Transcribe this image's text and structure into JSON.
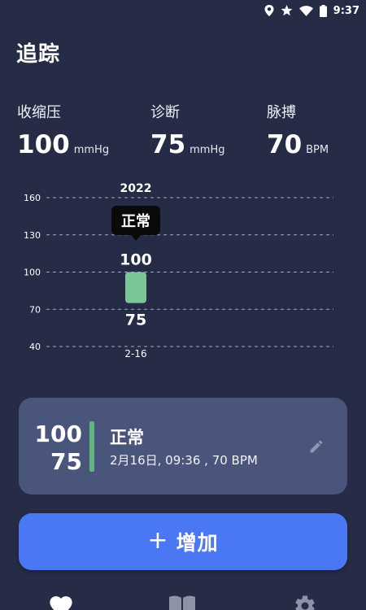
{
  "status_bar": {
    "time": "9:37",
    "icons": [
      "location-icon",
      "star-icon",
      "wifi-icon",
      "battery-icon"
    ]
  },
  "header": {
    "title": "追踪"
  },
  "metrics": [
    {
      "label": "收缩压",
      "value": "100",
      "unit": "mmHg"
    },
    {
      "label": "诊断",
      "value": "75",
      "unit": "mmHg"
    },
    {
      "label": "脉搏",
      "value": "70",
      "unit": "BPM"
    }
  ],
  "chart_data": {
    "type": "bar",
    "title": "",
    "year_label": "2022",
    "y_ticks": [
      160,
      130,
      100,
      70,
      40
    ],
    "ylim": [
      40,
      160
    ],
    "grid": true,
    "categories": [
      "2-16"
    ],
    "bars": [
      {
        "x": "2-16",
        "low": 75,
        "high": 100,
        "status": "正常"
      }
    ],
    "colors": {
      "bar": "#7cc596",
      "grid": "#a5aac0",
      "tooltip_bg": "#0a0a0a"
    }
  },
  "record": {
    "systolic": "100",
    "diastolic": "75",
    "status": "正常",
    "detail": "2月16日, 09:36 , 70 BPM",
    "status_color": "#5fb57c"
  },
  "add_button": {
    "plus": "+",
    "label": "增加"
  },
  "bottom_nav": {
    "items": [
      {
        "icon": "heart-icon",
        "active": true
      },
      {
        "icon": "book-icon",
        "active": false
      },
      {
        "icon": "gear-icon",
        "active": false
      }
    ]
  },
  "colors": {
    "background": "#262c46",
    "card": "#4a557c",
    "accent": "#4a78f5",
    "normal": "#5fb57c"
  }
}
